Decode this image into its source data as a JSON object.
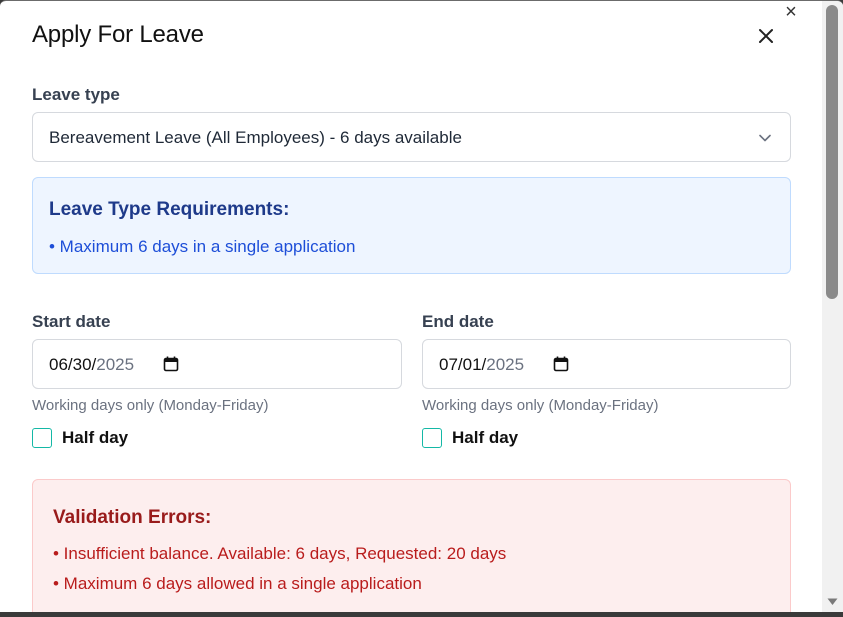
{
  "dialog": {
    "title": "Apply For Leave",
    "outer_close_icon": "close-icon",
    "inner_close_icon": "close-icon"
  },
  "leave_type": {
    "label": "Leave type",
    "selected": "Bereavement Leave (All Employees) - 6 days available",
    "chevron_icon": "chevron-down-icon"
  },
  "requirements": {
    "title": "Leave Type Requirements:",
    "items": [
      "• Maximum 6 days in a single application"
    ]
  },
  "start_date": {
    "label": "Start date",
    "month_day": "06/30/",
    "year": "2025",
    "hint": "Working days only (Monday-Friday)",
    "half_day_label": "Half day",
    "half_day_checked": false
  },
  "end_date": {
    "label": "End date",
    "month_day": "07/01/",
    "year": "2025",
    "hint": "Working days only (Monday-Friday)",
    "half_day_label": "Half day",
    "half_day_checked": false
  },
  "validation": {
    "title": "Validation Errors:",
    "items": [
      "• Insufficient balance. Available: 6 days, Requested: 20 days",
      "• Maximum 6 days allowed in a single application"
    ]
  },
  "colors": {
    "checkbox_border": "#14b8a6",
    "info_bg": "#eef5ff",
    "info_text": "#1d4ed8",
    "error_bg": "#fdeeee",
    "error_text": "#b91c1c"
  }
}
